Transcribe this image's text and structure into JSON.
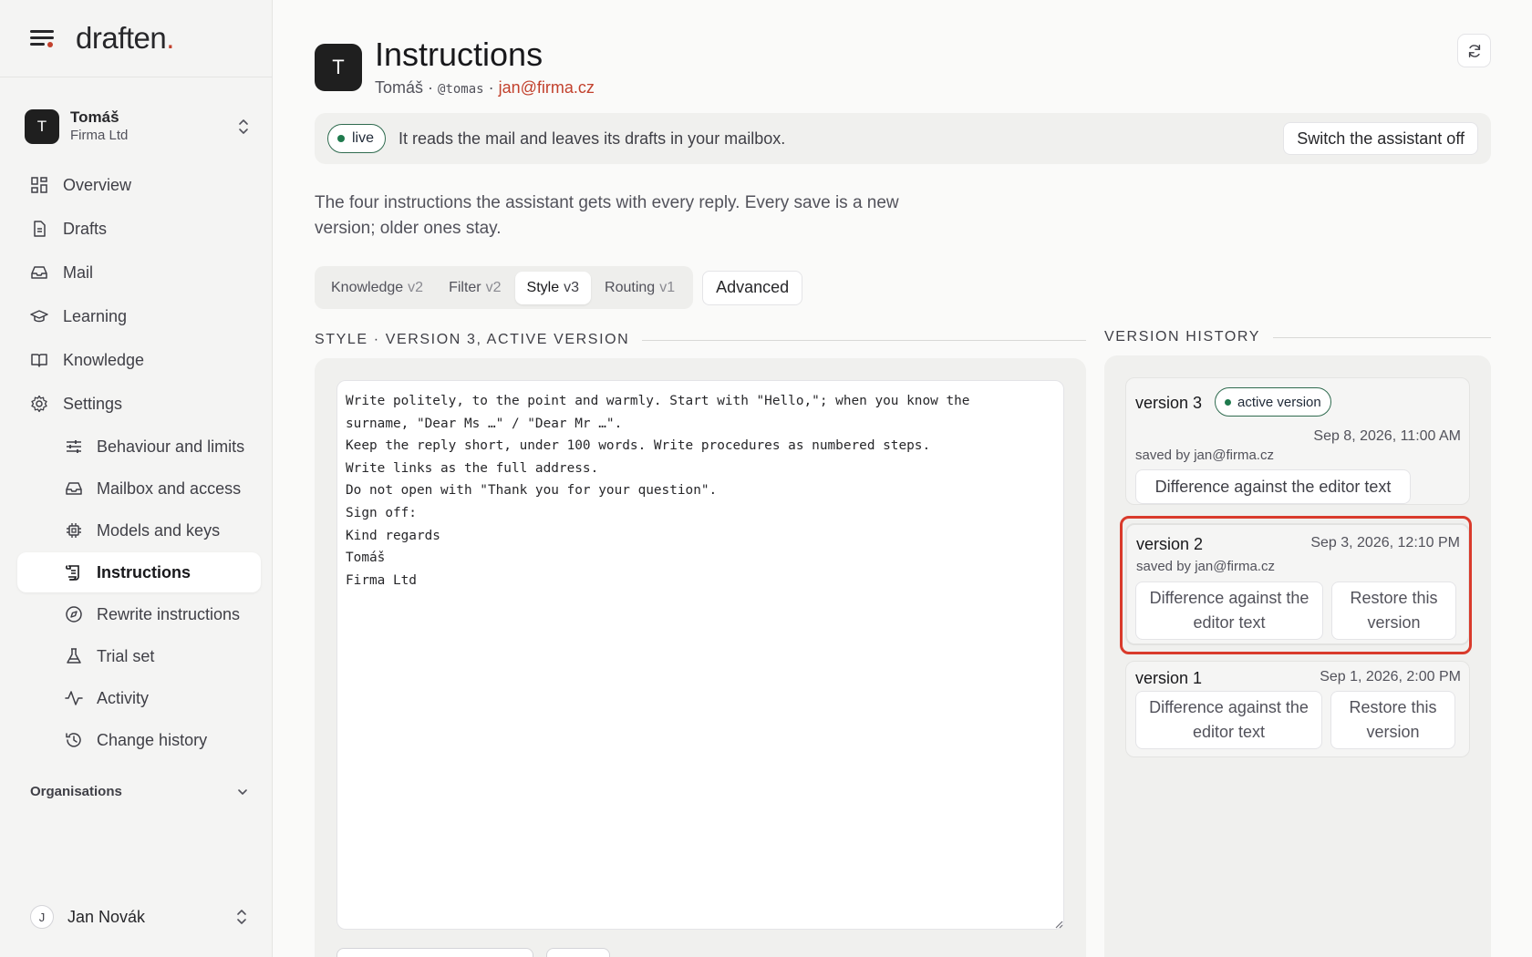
{
  "brand": {
    "name": "draften",
    "accent": "."
  },
  "org": {
    "initial": "T",
    "name": "Tomáš",
    "company": "Firma Ltd"
  },
  "nav": {
    "overview": "Overview",
    "drafts": "Drafts",
    "mail": "Mail",
    "learning": "Learning",
    "knowledge": "Knowledge",
    "settings": "Settings",
    "behaviour": "Behaviour and limits",
    "mailbox": "Mailbox and access",
    "models": "Models and keys",
    "instructions": "Instructions",
    "rewrite": "Rewrite instructions",
    "trial": "Trial set",
    "activity": "Activity",
    "change_history": "Change history"
  },
  "organisations_label": "Organisations",
  "user": {
    "initial": "J",
    "name": "Jan Novák"
  },
  "header": {
    "initial": "T",
    "title": "Instructions",
    "name": "Tomáš",
    "sep1": " · ",
    "handle": "@tomas",
    "sep2": " · ",
    "email": "jan@firma.cz"
  },
  "status": {
    "badge": "live",
    "text": "It reads the mail and leaves its drafts in your mailbox.",
    "switch_off": "Switch the assistant off"
  },
  "intro": "The four instructions the assistant gets with every reply. Every save is a new version; older ones stay.",
  "tabs": [
    {
      "label": "Knowledge",
      "version": "v2"
    },
    {
      "label": "Filter",
      "version": "v2"
    },
    {
      "label": "Style",
      "version": "v3"
    },
    {
      "label": "Routing",
      "version": "v1"
    }
  ],
  "advanced": "Advanced",
  "editor_label": "STYLE · VERSION 3, ACTIVE VERSION",
  "editor_text": "Write politely, to the point and warmly. Start with \"Hello,\"; when you know the\nsurname, \"Dear Ms …\" / \"Dear Mr …\".\nKeep the reply short, under 100 words. Write procedures as numbered steps.\nWrite links as the full address.\nDo not open with \"Thank you for your question\".\nSign off:\nKind regards\nTomáš\nFirma Ltd",
  "history_label": "VERSION HISTORY",
  "versions": [
    {
      "title": "version 3",
      "badge": "active version",
      "date": "Sep 8, 2026, 11:00 AM",
      "saved_by": "saved by jan@firma.cz",
      "diff": "Difference against the editor text"
    },
    {
      "title": "version 2",
      "date": "Sep 3, 2026, 12:10 PM",
      "saved_by": "saved by jan@firma.cz",
      "diff": "Difference against the editor text",
      "restore": "Restore this version"
    },
    {
      "title": "version 1",
      "date": "Sep 1, 2026, 2:00 PM",
      "diff": "Difference against the editor text",
      "restore": "Restore this version"
    }
  ],
  "colors": {
    "accent": "#c2412d",
    "live": "#1f7a4d",
    "highlight": "#d93a2b"
  }
}
